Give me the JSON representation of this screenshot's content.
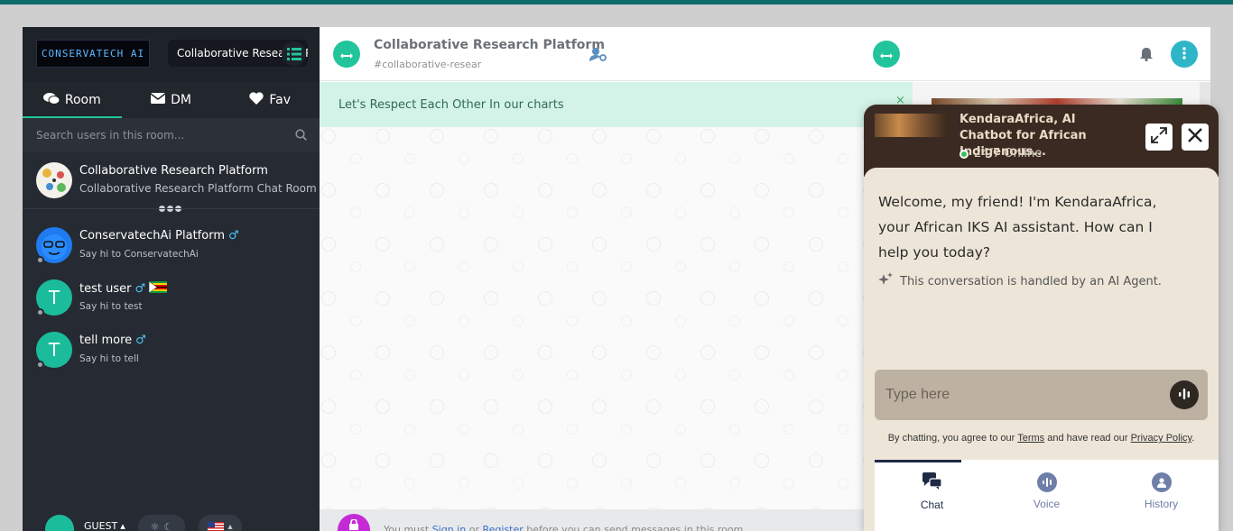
{
  "sidebar": {
    "logo_text": "CONSERVATECH AI",
    "room_name": "Collaborative Research Platform",
    "tabs": [
      {
        "label": "Room",
        "icon": "chat-bubbles-icon"
      },
      {
        "label": "DM",
        "icon": "envelope-icon"
      },
      {
        "label": "Fav",
        "icon": "heart-icon"
      }
    ],
    "search_placeholder": "Search users in this room...",
    "items": [
      {
        "name": "Collaborative Research Platform",
        "sub": "Collaborative Research Platform Chat Room"
      },
      {
        "name": "ConservatechAi Platform",
        "sub": "Say hi to ConservatechAi",
        "gender": "♂"
      },
      {
        "name": "test user",
        "sub": "Say hi to test",
        "gender": "♂",
        "initial": "T"
      },
      {
        "name": "tell more",
        "sub": "Say hi to tell",
        "gender": "♂",
        "initial": "T"
      }
    ],
    "user_role": "GUEST"
  },
  "header": {
    "title": "Collaborative Research Platform",
    "subtitle": "#collaborative-resear"
  },
  "notice": {
    "text": "Let's Respect Each Other In our charts",
    "close": "×"
  },
  "input_bar": {
    "text_before": "You must",
    "link1": "Sign in",
    "or": "or",
    "link2": "Register",
    "text_after": "before you can send messages in this room"
  },
  "chatbot": {
    "title": "KendaraAfrica, AI Chatbot for African Indigenous...",
    "status": "24/7 Online",
    "welcome": "Welcome, my friend! I'm KendaraAfrica, your African IKS AI assistant. How can I help you today?",
    "note": "This conversation is handled by an AI Agent.",
    "input_placeholder": "Type here",
    "terms_prefix": "By chatting, you agree to our",
    "terms_link": "Terms",
    "terms_mid": "and have read our",
    "privacy_link": "Privacy Policy",
    "terms_suffix": ".",
    "nav": [
      {
        "label": "Chat",
        "icon": "chat-icon",
        "active": true
      },
      {
        "label": "Voice",
        "icon": "voice-icon",
        "active": false
      },
      {
        "label": "History",
        "icon": "history-icon",
        "active": false
      }
    ]
  },
  "colors": {
    "accent": "#22c49b",
    "sidebar_bg": "#262b33",
    "notice_bg": "#d4f3e8",
    "widget_header": "#3a2a22",
    "widget_body": "#ede6d8"
  }
}
